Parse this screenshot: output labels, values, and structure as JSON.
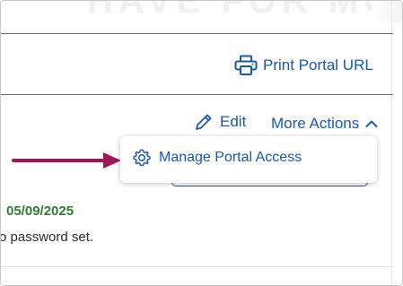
{
  "header": {
    "ghost_title": "HAVE FOR MOR PR"
  },
  "toolbar": {
    "print_label": "Print Portal URL"
  },
  "actions": {
    "edit_label": "Edit",
    "more_label": "More Actions"
  },
  "dropdown": {
    "items": [
      {
        "label": "Manage Portal Access",
        "icon": "gear-icon"
      }
    ]
  },
  "details": {
    "date": "05/09/2025",
    "password_text": "o password set."
  },
  "colors": {
    "link": "#1a58a8",
    "arrow": "#a3155b",
    "date": "#2e7d32"
  }
}
